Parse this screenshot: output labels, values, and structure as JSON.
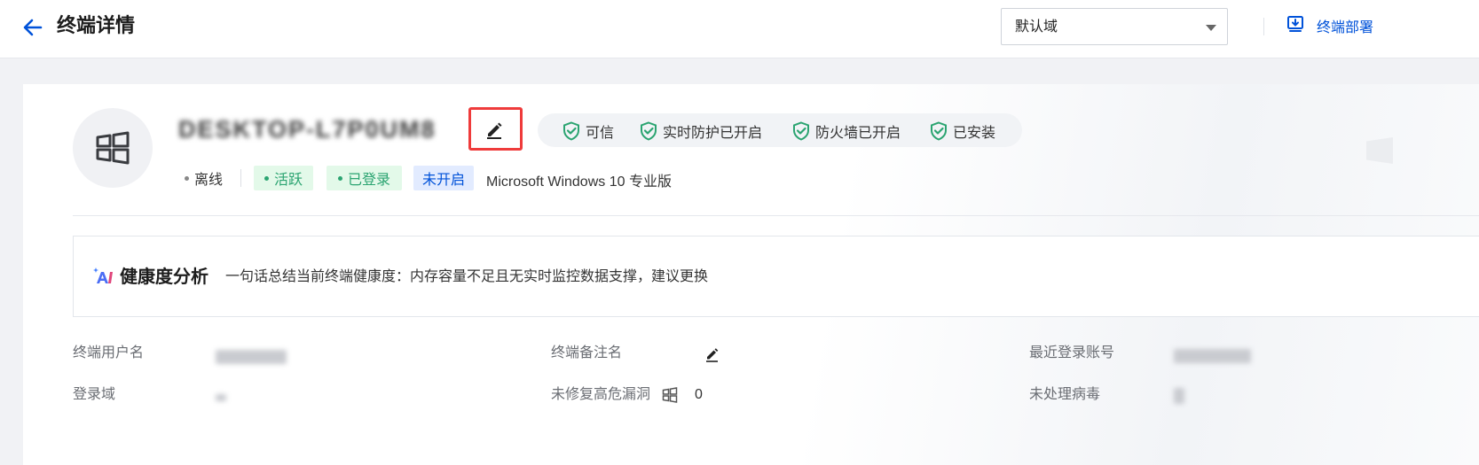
{
  "header": {
    "title": "终端详情",
    "domain_select": {
      "value": "默认域"
    },
    "deploy_link": "终端部署"
  },
  "terminal": {
    "hostname": "DESKTOP-L7P0UM8",
    "status_badges": [
      "可信",
      "实时防护已开启",
      "防火墙已开启",
      "已安装"
    ],
    "online_status": "离线",
    "tags": [
      "活跃",
      "已登录",
      "未开启"
    ],
    "os": "Microsoft Windows 10 专业版"
  },
  "health": {
    "title": "健康度分析",
    "summary": "一句话总结当前终端健康度：内存容量不足且无实时监控数据支撑，建议更换"
  },
  "info": {
    "username_label": "终端用户名",
    "remark_label": "终端备注名",
    "last_login_label": "最近登录账号",
    "login_domain_label": "登录域",
    "vuln_label": "未修复高危漏洞",
    "vuln_value": "0",
    "virus_label": "未处理病毒"
  },
  "colors": {
    "primary": "#0052d9",
    "success": "#2ba471",
    "highlight_border": "#ef3b3b"
  }
}
